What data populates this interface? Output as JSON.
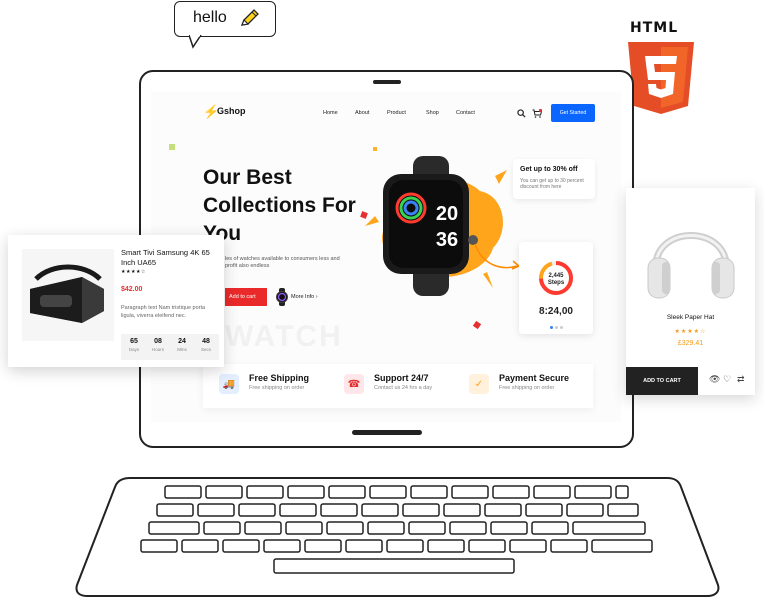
{
  "bubble": {
    "text": "hello",
    "icon": "pencil-icon"
  },
  "html5": {
    "label": "HTML",
    "digit": "5",
    "color": "#e44d26"
  },
  "site": {
    "logo": "Gshop",
    "nav": [
      "Home",
      "About",
      "Product",
      "Shop",
      "Contact"
    ],
    "cta": "Get Started",
    "hero_title": "Our Best Collections For You",
    "hero_desc": "les of watches available to consumers less and profit also endless",
    "add_to_cart": "Add to cart",
    "more_info": "More Info",
    "ghost_word": "WATCH",
    "watch_face": {
      "top": "20",
      "bottom": "36"
    },
    "offer": {
      "title": "Get up to 30% off",
      "sub": "You can get up to 30 percent discount from here"
    },
    "steps": {
      "count": "2,445",
      "label": "Steps",
      "time": "8:24,00"
    },
    "features": [
      {
        "title": "Free Shipping",
        "sub": "Free shipping on order",
        "color": "#e8f1ff",
        "glyph": "🚚"
      },
      {
        "title": "Support 24/7",
        "sub": "Contact us 24 hrs a day",
        "color": "#ffe9ea",
        "glyph": "☎"
      },
      {
        "title": "Payment Secure",
        "sub": "Free shipping on order",
        "color": "#fff3e0",
        "glyph": "✓"
      }
    ],
    "accent": "#ff9d1a"
  },
  "product_left": {
    "title": "Smart Tivi Samsung 4K 65 Inch UA65",
    "stars": "★★★★☆",
    "price": "$42.00",
    "desc": "Paragraph text Nam tristique porta ligula, viverra eleifend nec.",
    "countdown": [
      {
        "value": "65",
        "label": "Days"
      },
      {
        "value": "08",
        "label": "Hours"
      },
      {
        "value": "24",
        "label": "Mins"
      },
      {
        "value": "48",
        "label": "Secs"
      }
    ]
  },
  "product_right": {
    "title": "Sleek Paper Hat",
    "stars": "★★★★☆",
    "price": "£329.41",
    "add_to_cart": "ADD TO CART"
  }
}
